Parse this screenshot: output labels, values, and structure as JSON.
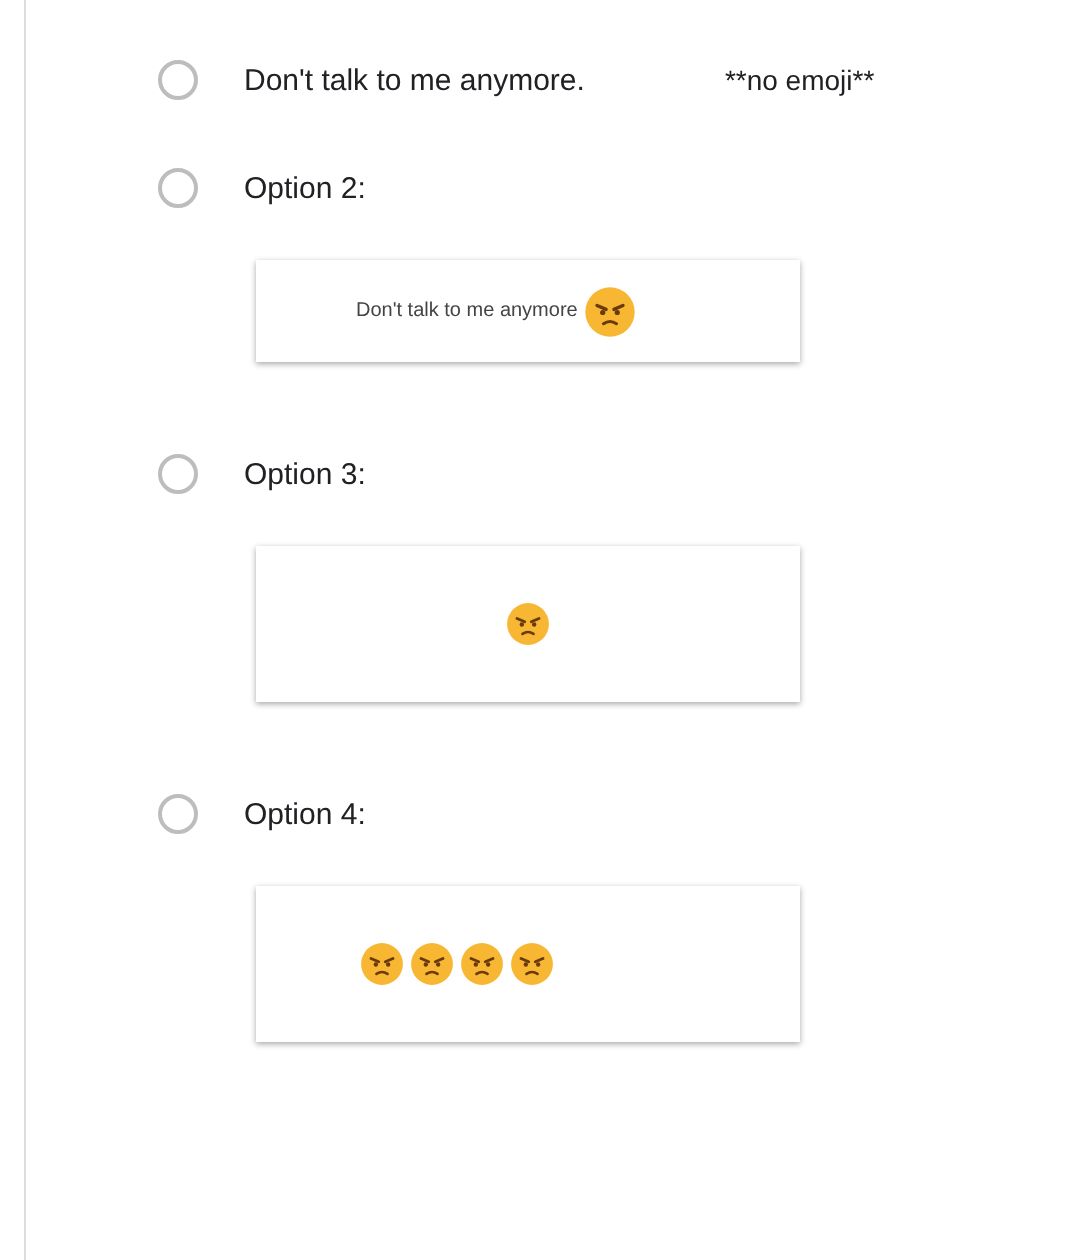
{
  "options": [
    {
      "label": "Don't talk to me anymore.",
      "note": "**no emoji**",
      "selected": false
    },
    {
      "label": "Option 2:",
      "selected": false,
      "image": {
        "items": [
          {
            "kind": "text",
            "text": "Don't talk to me anymore"
          },
          {
            "kind": "emoji"
          }
        ]
      }
    },
    {
      "label": "Option 3:",
      "selected": false,
      "image": {
        "items": [
          {
            "kind": "emoji"
          }
        ]
      }
    },
    {
      "label": "Option 4:",
      "selected": false,
      "image": {
        "items": [
          {
            "kind": "emoji"
          },
          {
            "kind": "emoji"
          },
          {
            "kind": "emoji"
          },
          {
            "kind": "emoji"
          }
        ]
      }
    }
  ]
}
